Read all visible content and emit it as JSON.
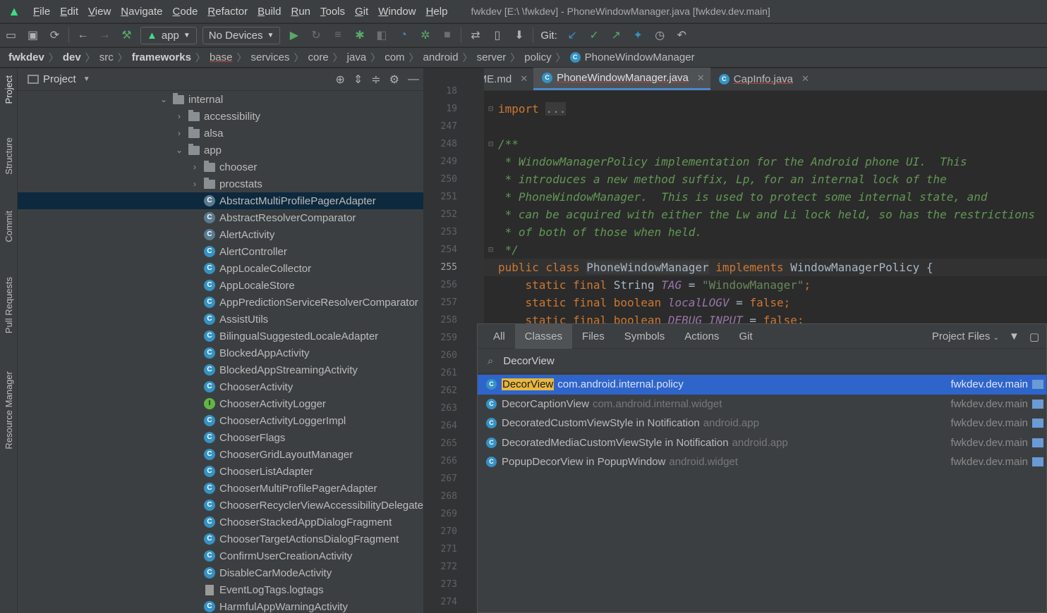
{
  "menubar": {
    "items": [
      "File",
      "Edit",
      "View",
      "Navigate",
      "Code",
      "Refactor",
      "Build",
      "Run",
      "Tools",
      "Git",
      "Window",
      "Help"
    ],
    "underlines": [
      "F",
      "E",
      "V",
      "N",
      "C",
      "R",
      "B",
      "R",
      "T",
      "G",
      "W",
      "H"
    ],
    "title": "fwkdev [E:\\                    \\fwkdev] - PhoneWindowManager.java [fwkdev.dev.main]"
  },
  "toolbar": {
    "run_config": "app",
    "device": "No Devices",
    "git_label": "Git:"
  },
  "breadcrumb": [
    "fwkdev",
    "dev",
    "src",
    "frameworks",
    "base",
    "services",
    "core",
    "java",
    "com",
    "android",
    "server",
    "policy",
    "PhoneWindowManager"
  ],
  "sidebar_strip": [
    "Project",
    "Structure",
    "Commit",
    "Pull Requests",
    "Resource Manager"
  ],
  "project": {
    "title": "Project",
    "tree": [
      {
        "label": "internal",
        "kind": "folder",
        "depth": 0,
        "expanded": true
      },
      {
        "label": "accessibility",
        "kind": "folder",
        "depth": 1,
        "expanded": false
      },
      {
        "label": "alsa",
        "kind": "folder",
        "depth": 1,
        "expanded": false
      },
      {
        "label": "app",
        "kind": "folder",
        "depth": 1,
        "expanded": true
      },
      {
        "label": "chooser",
        "kind": "folder",
        "depth": 2,
        "expanded": false
      },
      {
        "label": "procstats",
        "kind": "folder",
        "depth": 2,
        "expanded": false
      },
      {
        "label": "AbstractMultiProfilePagerAdapter",
        "kind": "abstract",
        "depth": 2,
        "selected": true
      },
      {
        "label": "AbstractResolverComparator",
        "kind": "abstract",
        "depth": 2
      },
      {
        "label": "AlertActivity",
        "kind": "abstract",
        "depth": 2
      },
      {
        "label": "AlertController",
        "kind": "class",
        "depth": 2
      },
      {
        "label": "AppLocaleCollector",
        "kind": "class",
        "depth": 2
      },
      {
        "label": "AppLocaleStore",
        "kind": "class",
        "depth": 2
      },
      {
        "label": "AppPredictionServiceResolverComparator",
        "kind": "class",
        "depth": 2
      },
      {
        "label": "AssistUtils",
        "kind": "class",
        "depth": 2
      },
      {
        "label": "BilingualSuggestedLocaleAdapter",
        "kind": "class",
        "depth": 2
      },
      {
        "label": "BlockedAppActivity",
        "kind": "class",
        "depth": 2
      },
      {
        "label": "BlockedAppStreamingActivity",
        "kind": "class",
        "depth": 2
      },
      {
        "label": "ChooserActivity",
        "kind": "class",
        "depth": 2
      },
      {
        "label": "ChooserActivityLogger",
        "kind": "interface",
        "depth": 2
      },
      {
        "label": "ChooserActivityLoggerImpl",
        "kind": "class",
        "depth": 2
      },
      {
        "label": "ChooserFlags",
        "kind": "class",
        "depth": 2
      },
      {
        "label": "ChooserGridLayoutManager",
        "kind": "class",
        "depth": 2
      },
      {
        "label": "ChooserListAdapter",
        "kind": "class",
        "depth": 2
      },
      {
        "label": "ChooserMultiProfilePagerAdapter",
        "kind": "class",
        "depth": 2
      },
      {
        "label": "ChooserRecyclerViewAccessibilityDelegate",
        "kind": "class",
        "depth": 2
      },
      {
        "label": "ChooserStackedAppDialogFragment",
        "kind": "class",
        "depth": 2
      },
      {
        "label": "ChooserTargetActionsDialogFragment",
        "kind": "class",
        "depth": 2
      },
      {
        "label": "ConfirmUserCreationActivity",
        "kind": "class",
        "depth": 2
      },
      {
        "label": "DisableCarModeActivity",
        "kind": "class",
        "depth": 2
      },
      {
        "label": "EventLogTags.logtags",
        "kind": "file",
        "depth": 2
      },
      {
        "label": "HarmfulAppWarningActivity",
        "kind": "class",
        "depth": 2
      }
    ]
  },
  "tabs": [
    {
      "label": "README.md",
      "active": false,
      "icon": "md"
    },
    {
      "label": "PhoneWindowManager.java",
      "active": true,
      "icon": "class"
    },
    {
      "label": "CapInfo.java",
      "active": false,
      "icon": "class"
    }
  ],
  "editor": {
    "line_numbers": [
      "18",
      "19",
      "247",
      "248",
      "249",
      "250",
      "251",
      "252",
      "253",
      "254",
      "255",
      "256",
      "257",
      "258",
      "259",
      "260",
      "261",
      "262",
      "263",
      "264",
      "265",
      "266",
      "267",
      "268",
      "269",
      "270",
      "271",
      "272",
      "273",
      "274"
    ],
    "current_line": "255",
    "lines": [
      {
        "parts": []
      },
      {
        "parts": [
          {
            "t": "import ",
            "c": "kw"
          },
          {
            "t": "...",
            "c": "dim"
          }
        ]
      },
      {
        "parts": []
      },
      {
        "parts": [
          {
            "t": "/**",
            "c": "doc"
          }
        ]
      },
      {
        "parts": [
          {
            "t": " * WindowManagerPolicy implementation for the Android phone UI.  This",
            "c": "doc"
          }
        ]
      },
      {
        "parts": [
          {
            "t": " * introduces a new method suffix, Lp, for an internal lock of the",
            "c": "doc"
          }
        ]
      },
      {
        "parts": [
          {
            "t": " * PhoneWindowManager.  This is used to protect some internal state, and",
            "c": "doc"
          }
        ]
      },
      {
        "parts": [
          {
            "t": " * can be acquired with either the Lw and Li lock held, so has the restrictions",
            "c": "doc"
          }
        ]
      },
      {
        "parts": [
          {
            "t": " * of both of those when held.",
            "c": "doc"
          }
        ]
      },
      {
        "parts": [
          {
            "t": " */",
            "c": "doc"
          }
        ]
      },
      {
        "parts": [
          {
            "t": "public class ",
            "c": "kw"
          },
          {
            "t": "PhoneWindowManager",
            "c": "plain"
          },
          {
            "t": " implements ",
            "c": "kw"
          },
          {
            "t": "WindowManagerPolicy {",
            "c": "plain"
          }
        ]
      },
      {
        "parts": [
          {
            "t": "    static final ",
            "c": "kw"
          },
          {
            "t": "String ",
            "c": "plain"
          },
          {
            "t": "TAG",
            "c": "cst"
          },
          {
            "t": " = ",
            "c": "plain"
          },
          {
            "t": "\"WindowManager\"",
            "c": "str"
          },
          {
            "t": ";",
            "c": "kw"
          }
        ]
      },
      {
        "parts": [
          {
            "t": "    static final boolean ",
            "c": "kw"
          },
          {
            "t": "localLOGV",
            "c": "cst"
          },
          {
            "t": " = ",
            "c": "plain"
          },
          {
            "t": "false",
            "c": "kw"
          },
          {
            "t": ";",
            "c": "kw"
          }
        ]
      },
      {
        "parts": [
          {
            "t": "    static final boolean ",
            "c": "kw"
          },
          {
            "t": "DEBUG_INPUT",
            "c": "cst"
          },
          {
            "t": " = ",
            "c": "plain"
          },
          {
            "t": "false",
            "c": "kw"
          },
          {
            "t": ";",
            "c": "kw"
          }
        ]
      }
    ]
  },
  "search_popup": {
    "tabs": [
      "All",
      "Classes",
      "Files",
      "Symbols",
      "Actions",
      "Git"
    ],
    "active_tab": "Classes",
    "scope": "Project Files",
    "query": "DecorView",
    "results": [
      {
        "name": "DecorView",
        "highlight": "DecorView",
        "rest": "",
        "pkg": "com.android.internal.policy",
        "module": "fwkdev.dev.main",
        "selected": true
      },
      {
        "name": "DecorCaptionView",
        "highlight": "",
        "rest": "DecorCaptionView",
        "pkg": "com.android.internal.widget",
        "module": "fwkdev.dev.main",
        "selected": false
      },
      {
        "name": "DecoratedCustomViewStyle in Notification",
        "highlight": "",
        "rest": "DecoratedCustomViewStyle in Notification",
        "pkg": "android.app",
        "module": "fwkdev.dev.main",
        "selected": false
      },
      {
        "name": "DecoratedMediaCustomViewStyle in Notification",
        "highlight": "",
        "rest": "DecoratedMediaCustomViewStyle in Notification",
        "pkg": "android.app",
        "module": "fwkdev.dev.main",
        "selected": false
      },
      {
        "name": "PopupDecorView in PopupWindow",
        "highlight": "",
        "rest": "PopupDecorView in PopupWindow",
        "pkg": "android.widget",
        "module": "fwkdev.dev.main",
        "selected": false
      }
    ]
  },
  "colors": {
    "background": "#2b2b2b",
    "panel": "#3c3f41",
    "accent": "#2f65ca",
    "selection": "#0d293e",
    "keyword": "#cc7832",
    "doc": "#629755",
    "string": "#6a8759",
    "constant": "#9876aa",
    "highlight": "#e8b73f"
  }
}
